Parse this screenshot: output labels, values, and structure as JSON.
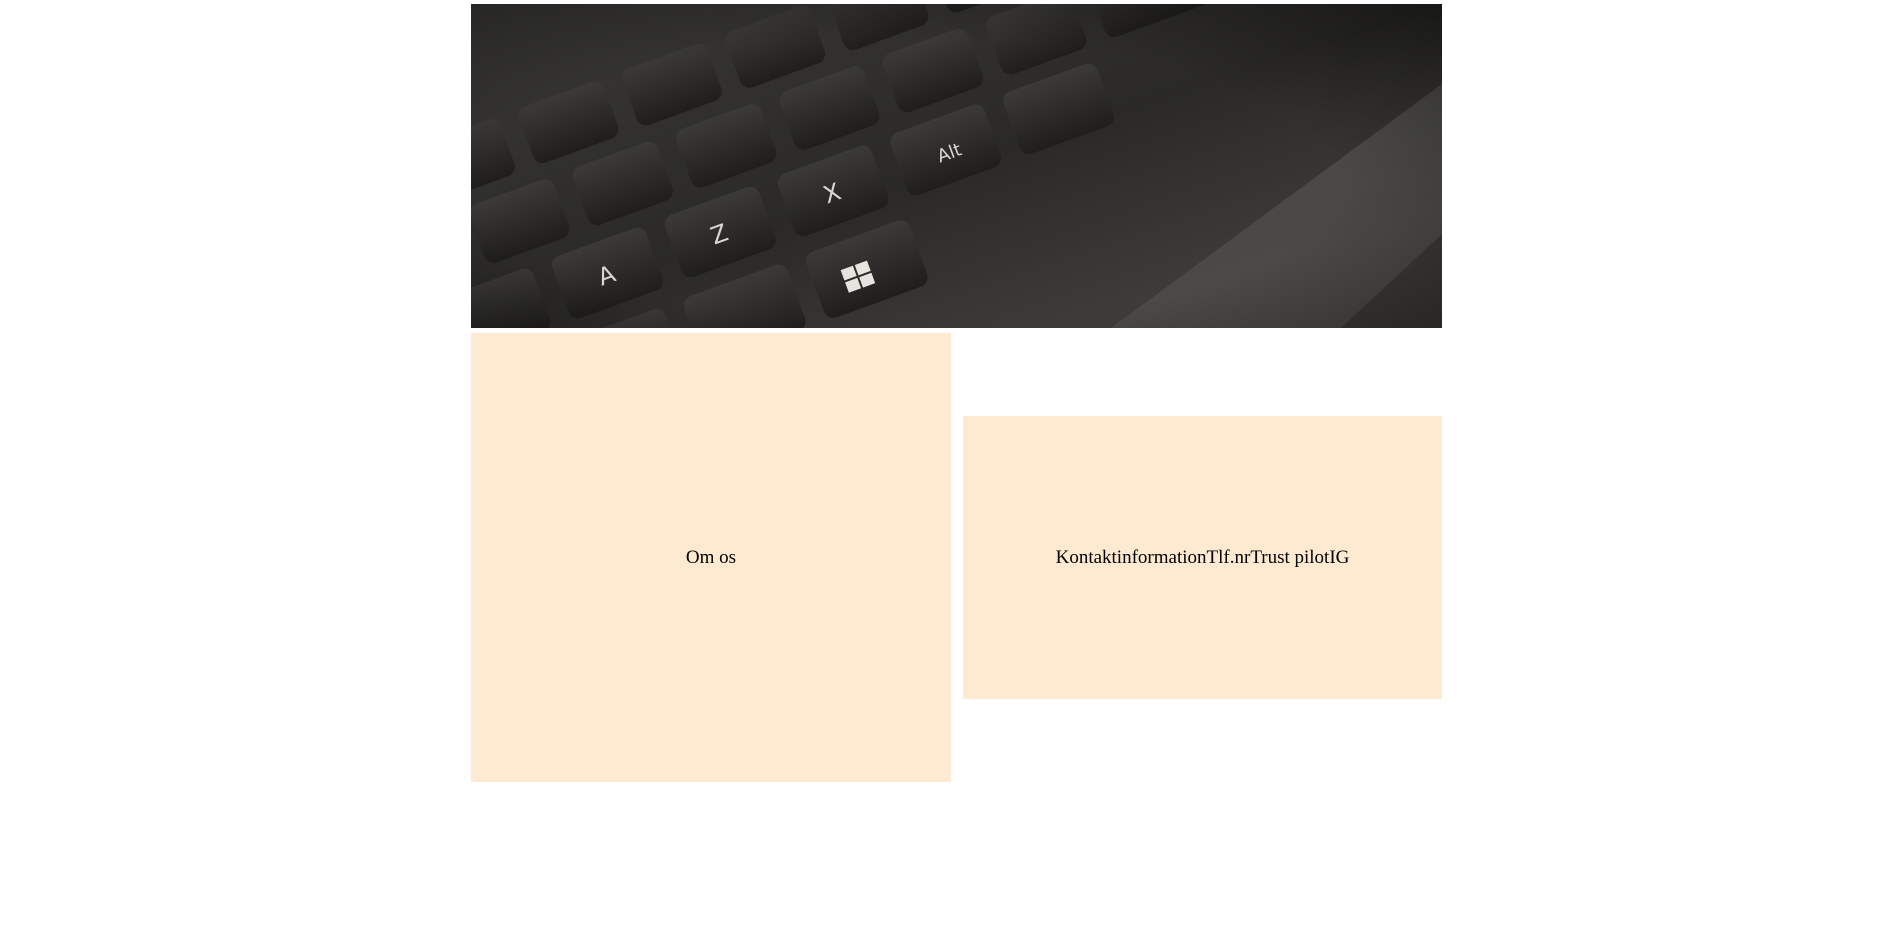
{
  "colors": {
    "panel_background": "#feead0",
    "page_background": "#ffffff",
    "text": "#000000"
  },
  "hero": {
    "image": "keyboard-photo"
  },
  "about": {
    "label": "Om os"
  },
  "contact": {
    "title": "Kontaktinformation",
    "phone_label": "Tlf.nr",
    "trustpilot_label": "Trust pilot",
    "instagram_label": "IG"
  }
}
